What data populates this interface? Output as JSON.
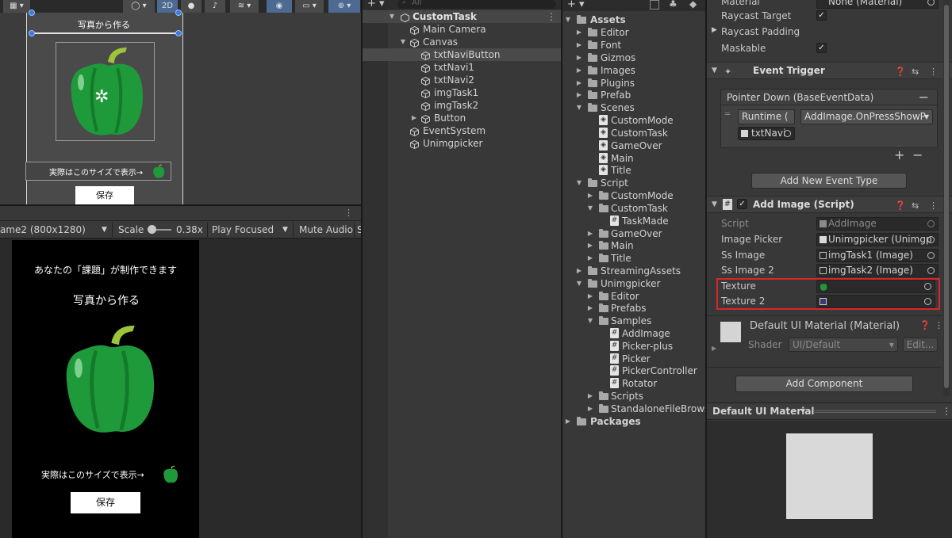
{
  "scene": {
    "toolbar": {
      "mode_2d": "2D"
    },
    "title_text": "写真から作る",
    "size_text": "実際はこのサイズで表示→",
    "save_label": "保存"
  },
  "game": {
    "toolbar": {
      "resolution": "ame2 (800x1280)",
      "scale_label": "Scale",
      "scale_value": "0.38x",
      "play_mode": "Play Focused",
      "mute": "Mute Audio",
      "stats_partial": "S"
    },
    "heading": "あなたの「課題」が制作できます",
    "title_text": "写真から作る",
    "size_text": "実際はこのサイズで表示→",
    "save_label": "保存"
  },
  "hierarchy": {
    "search_placeholder": "All",
    "scene_name": "CustomTask",
    "items": [
      {
        "label": "Main Camera"
      },
      {
        "label": "Canvas"
      },
      {
        "label": "txtNaviButton"
      },
      {
        "label": "txtNavi1"
      },
      {
        "label": "txtNavi2"
      },
      {
        "label": "imgTask1"
      },
      {
        "label": "imgTask2"
      },
      {
        "label": "Button"
      },
      {
        "label": "EventSystem"
      },
      {
        "label": "Unimgpicker"
      }
    ]
  },
  "project": {
    "items": [
      {
        "label": "Assets"
      },
      {
        "label": "Editor"
      },
      {
        "label": "Font"
      },
      {
        "label": "Gizmos"
      },
      {
        "label": "Images"
      },
      {
        "label": "Plugins"
      },
      {
        "label": "Prefab"
      },
      {
        "label": "Scenes"
      },
      {
        "label": "CustomMode"
      },
      {
        "label": "CustomTask"
      },
      {
        "label": "GameOver"
      },
      {
        "label": "Main"
      },
      {
        "label": "Title"
      },
      {
        "label": "Script"
      },
      {
        "label": "CustomMode"
      },
      {
        "label": "CustomTask"
      },
      {
        "label": "TaskMade"
      },
      {
        "label": "GameOver"
      },
      {
        "label": "Main"
      },
      {
        "label": "Title"
      },
      {
        "label": "StreamingAssets"
      },
      {
        "label": "Unimgpicker"
      },
      {
        "label": "Editor"
      },
      {
        "label": "Prefabs"
      },
      {
        "label": "Samples"
      },
      {
        "label": "AddImage"
      },
      {
        "label": "Picker-plus"
      },
      {
        "label": "Picker"
      },
      {
        "label": "PickerController"
      },
      {
        "label": "Rotator"
      },
      {
        "label": "Scripts"
      },
      {
        "label": "StandaloneFileBrows"
      },
      {
        "label": "Packages"
      }
    ]
  },
  "inspector": {
    "material_label": "Material",
    "material_value": "None (Material)",
    "raycast_target": "Raycast Target",
    "raycast_padding": "Raycast Padding",
    "maskable": "Maskable",
    "event_trigger": {
      "title": "Event Trigger",
      "event_name": "Pointer Down (BaseEventData)",
      "runtime": "Runtime (",
      "function": "AddImage.OnPressShowP",
      "target": "txtNavi",
      "add_event": "Add New Event Type"
    },
    "add_image": {
      "title": "Add Image (Script)",
      "fields": [
        {
          "label": "Script",
          "value": "AddImage"
        },
        {
          "label": "Image Picker",
          "value": "Unimgpicker (Unimgp"
        },
        {
          "label": "Ss Image",
          "value": "imgTask1 (Image)"
        },
        {
          "label": "Ss Image 2",
          "value": "imgTask2 (Image)"
        },
        {
          "label": "Texture",
          "value": ""
        },
        {
          "label": "Texture 2",
          "value": ""
        }
      ]
    },
    "material": {
      "title": "Default UI Material (Material)",
      "shader_label": "Shader",
      "shader_value": "UI/Default",
      "edit": "Edit..."
    },
    "add_component": "Add Component",
    "preview_label": "Default UI Material",
    "highlight_color": "#d8262b"
  }
}
